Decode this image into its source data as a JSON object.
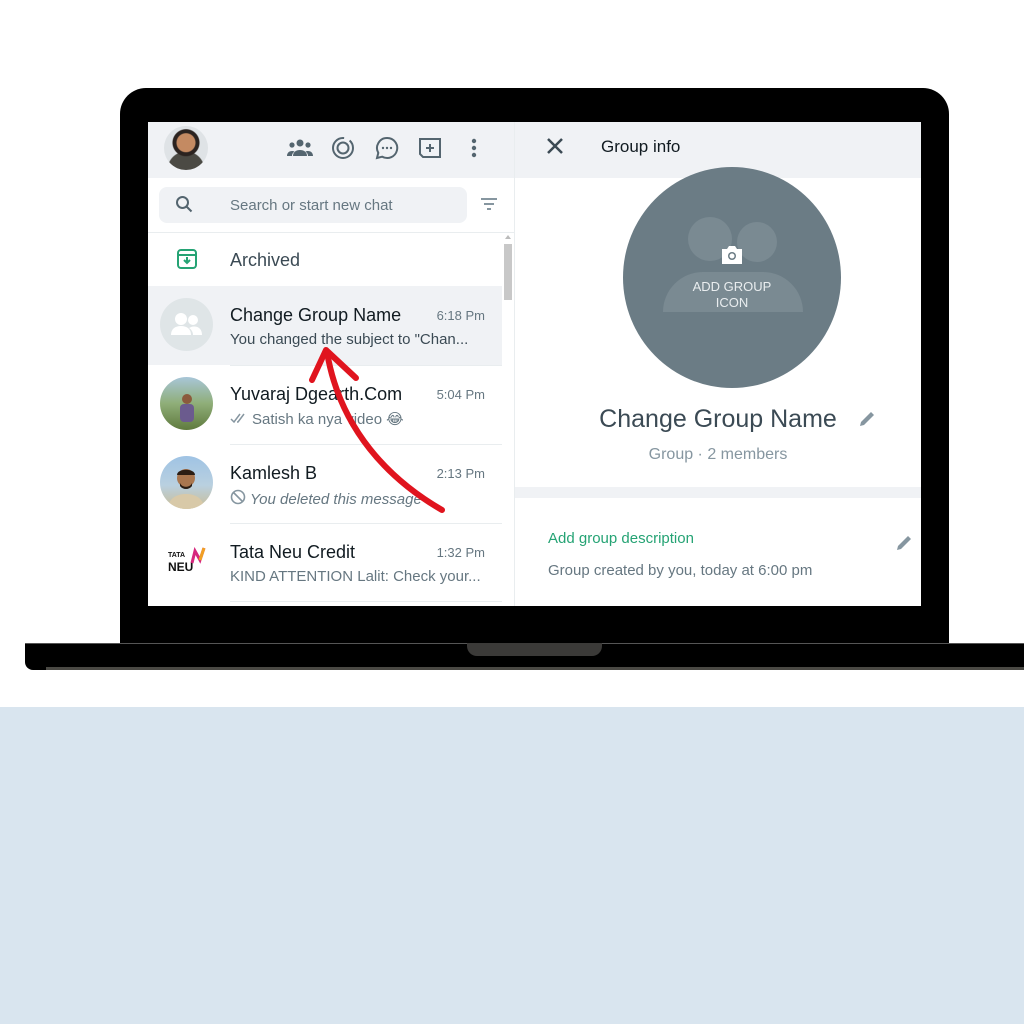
{
  "left_panel": {
    "header": {
      "icons": [
        "communities-icon",
        "status-icon",
        "channels-icon",
        "new-chat-icon",
        "menu-icon"
      ]
    },
    "search": {
      "placeholder": "Search or start new chat"
    },
    "archived_label": "Archived",
    "chats": [
      {
        "name": "Change Group Name",
        "time": "6:18 Pm",
        "message": "You changed the subject to \"Chan...",
        "selected": true
      },
      {
        "name": "Yuvaraj Dgearth.Com",
        "time": "5:04 Pm",
        "message": "Satish ka nya video",
        "emoji": "😂",
        "status": "double-check"
      },
      {
        "name": "Kamlesh B",
        "time": "2:13 Pm",
        "message": "You deleted this message",
        "status": "deleted"
      },
      {
        "name": "Tata Neu Credit",
        "time": "1:32 Pm",
        "message": "KIND ATTENTION Lalit: Check your...",
        "logo_top": "TATA",
        "logo_bottom": "NEU"
      }
    ]
  },
  "right_panel": {
    "title": "Group info",
    "group_icon_label_line1": "ADD GROUP",
    "group_icon_label_line2": "ICON",
    "group_name": "Change Group Name",
    "group_subtitle": "Group · 2 members",
    "add_description": "Add group description",
    "created_text": "Group created by you, today at 6:00 pm"
  },
  "colors": {
    "accent_green": "#25a374",
    "annotation_arrow": "#e0141e",
    "background_band": "#d9e5ef"
  }
}
